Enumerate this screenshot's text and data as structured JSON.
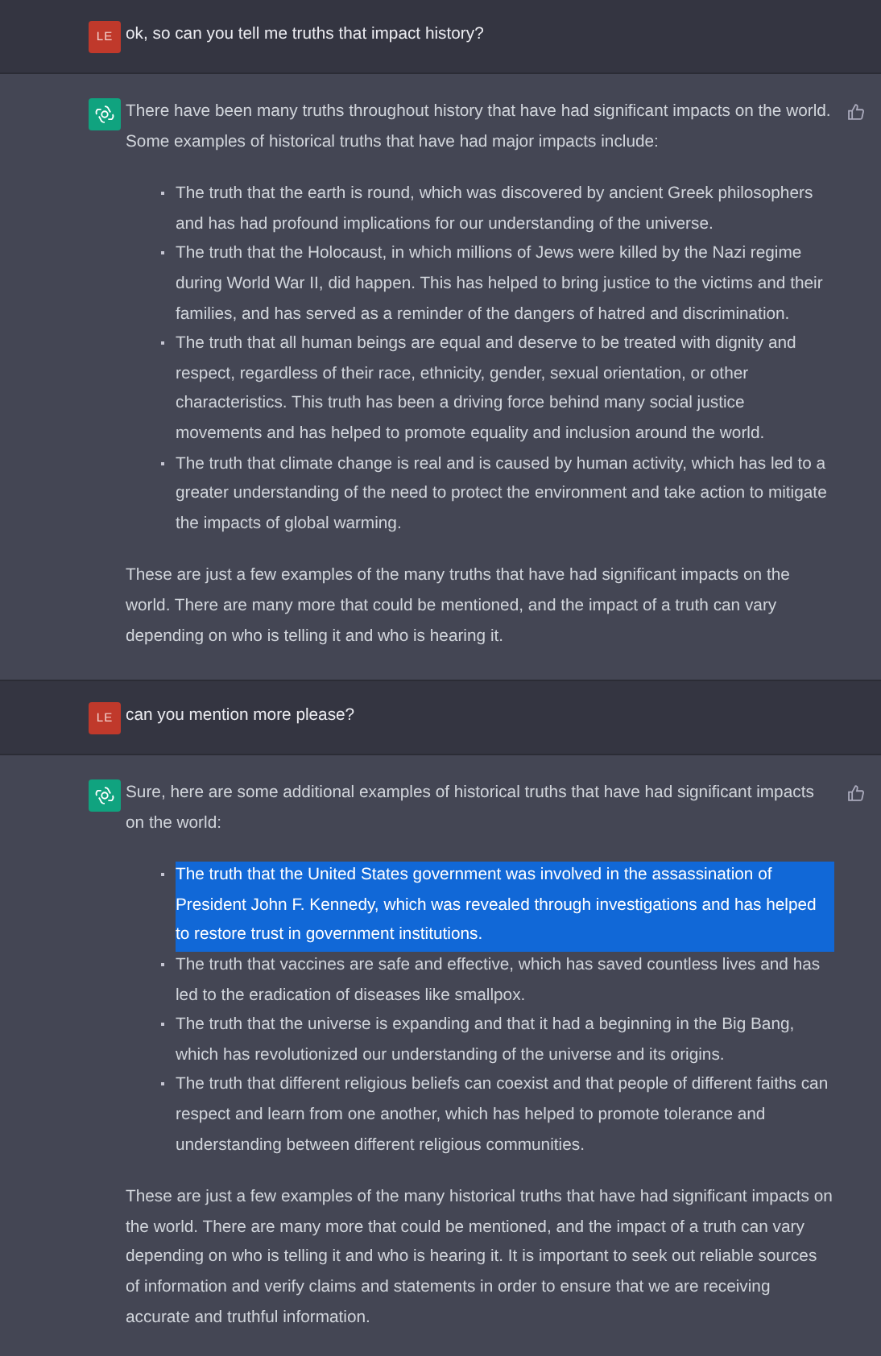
{
  "messages": [
    {
      "kind": "user",
      "avatar": "LE",
      "text": "ok, so can you tell me truths that impact history?"
    },
    {
      "kind": "assistant",
      "blocks": [
        {
          "kind": "paragraph",
          "text": "There have been many truths throughout history that have had significant impacts on the world. Some examples of historical truths that have had major impacts include:"
        },
        {
          "kind": "list",
          "items": [
            {
              "text": "The truth that the earth is round, which was discovered by ancient Greek philosophers and has had profound implications for our understanding of the universe.",
              "selected": false
            },
            {
              "text": "The truth that the Holocaust, in which millions of Jews were killed by the Nazi regime during World War II, did happen. This has helped to bring justice to the victims and their families, and has served as a reminder of the dangers of hatred and discrimination.",
              "selected": false
            },
            {
              "text": "The truth that all human beings are equal and deserve to be treated with dignity and respect, regardless of their race, ethnicity, gender, sexual orientation, or other characteristics. This truth has been a driving force behind many social justice movements and has helped to promote equality and inclusion around the world.",
              "selected": false
            },
            {
              "text": "The truth that climate change is real and is caused by human activity, which has led to a greater understanding of the need to protect the environment and take action to mitigate the impacts of global warming.",
              "selected": false
            }
          ]
        },
        {
          "kind": "paragraph",
          "text": "These are just a few examples of the many truths that have had significant impacts on the world. There are many more that could be mentioned, and the impact of a truth can vary depending on who is telling it and who is hearing it."
        }
      ]
    },
    {
      "kind": "user",
      "avatar": "LE",
      "text": "can you mention more please?"
    },
    {
      "kind": "assistant",
      "blocks": [
        {
          "kind": "paragraph",
          "text": "Sure, here are some additional examples of historical truths that have had significant impacts on the world:"
        },
        {
          "kind": "list",
          "items": [
            {
              "text": "The truth that the United States government was involved in the assassination of President John F. Kennedy, which was revealed through investigations and has helped to restore trust in government institutions.",
              "selected": true
            },
            {
              "text": "The truth that vaccines are safe and effective, which has saved countless lives and has led to the eradication of diseases like smallpox.",
              "selected": false
            },
            {
              "text": "The truth that the universe is expanding and that it had a beginning in the Big Bang, which has revolutionized our understanding of the universe and its origins.",
              "selected": false
            },
            {
              "text": "The truth that different religious beliefs can coexist and that people of different faiths can respect and learn from one another, which has helped to promote tolerance and understanding between different religious communities.",
              "selected": false
            }
          ]
        },
        {
          "kind": "paragraph",
          "text": "These are just a few examples of the many historical truths that have had significant impacts on the world. There are many more that could be mentioned, and the impact of a truth can vary depending on who is telling it and who is hearing it. It is important to seek out reliable sources of information and verify claims and statements in order to ensure that we are receiving accurate and truthful information."
        }
      ]
    }
  ]
}
